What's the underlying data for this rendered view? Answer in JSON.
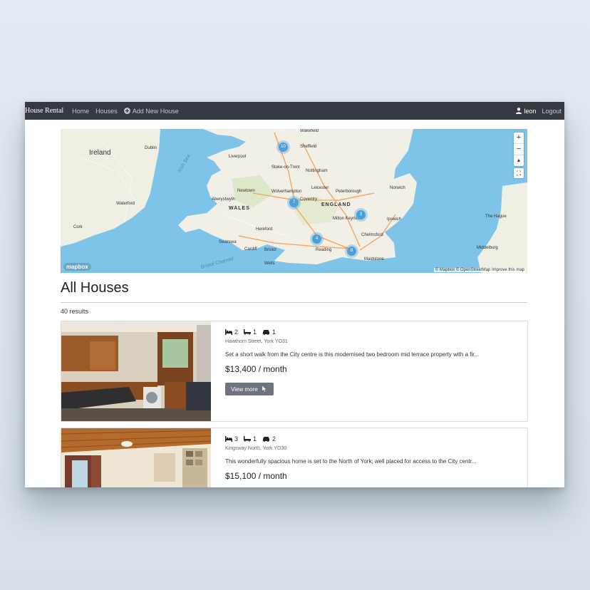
{
  "navbar": {
    "brand": "House Rental",
    "links": [
      "Home",
      "Houses",
      "Add New House"
    ],
    "user": "leon",
    "logout": "Logout"
  },
  "map": {
    "zoom_in": "+",
    "zoom_out": "−",
    "compass": "▲",
    "fullscreen": "⛶",
    "logo": "mapbox",
    "attribution": "© Mapbox © OpenStreetMap Improve this map",
    "labels": {
      "ireland": "Ireland",
      "dublin": "Dublin",
      "wales": "WALES",
      "england": "ENGLAND",
      "liverpool": "Liverpool",
      "sheffield": "Sheffield",
      "nottingham": "Nottingham",
      "leicester": "Leicester",
      "wolverhampton": "Wolverhampton",
      "coventry": "Coventry",
      "peterborough": "Peterborough",
      "norwich": "Norwich",
      "milton_keynes": "Milton Keynes",
      "cardiff": "Cardiff",
      "bristol": "Bristol",
      "swansea": "Swansea",
      "reading": "Reading",
      "ipswich": "Ipswich",
      "chelmsford": "Chelmsford",
      "the_hague": "The Hague",
      "middelburg": "Middelburg",
      "wells": "Wells",
      "waterford": "Waterford",
      "cork": "Cork",
      "irish_sea": "Irish Sea",
      "bristol_channel": "Bristol Channel",
      "wakefield": "Wakefield",
      "stoke": "Stoke-on-Trent",
      "aberystwyth": "Aberystwyth",
      "newtown": "Newtown",
      "hereford": "Hereford",
      "maidstone": "Maidstone"
    },
    "clusters": [
      "10",
      "7",
      "3",
      "4",
      "8"
    ]
  },
  "page": {
    "title": "All Houses",
    "results": "40 results"
  },
  "listings": [
    {
      "beds": "2",
      "baths": "1",
      "cars": "1",
      "address": "Hawthorn Street, York YO31",
      "description": "Set a short walk from the City centre is this modernised two bedroom mid terrace property with a fir...",
      "price": "$13,400 / month",
      "button": "View more"
    },
    {
      "beds": "3",
      "baths": "1",
      "cars": "2",
      "address": "Kingsway North, York YO30",
      "description": "This wonderfully spacious home is set to the North of York; well placed for access to the City centr...",
      "price": "$15,100 / month"
    }
  ],
  "colors": {
    "navbar": "#343a40",
    "cluster": "#4aa1d9",
    "sea": "#7ec3e8",
    "land": "#f1efe6",
    "button": "#6c757d"
  }
}
